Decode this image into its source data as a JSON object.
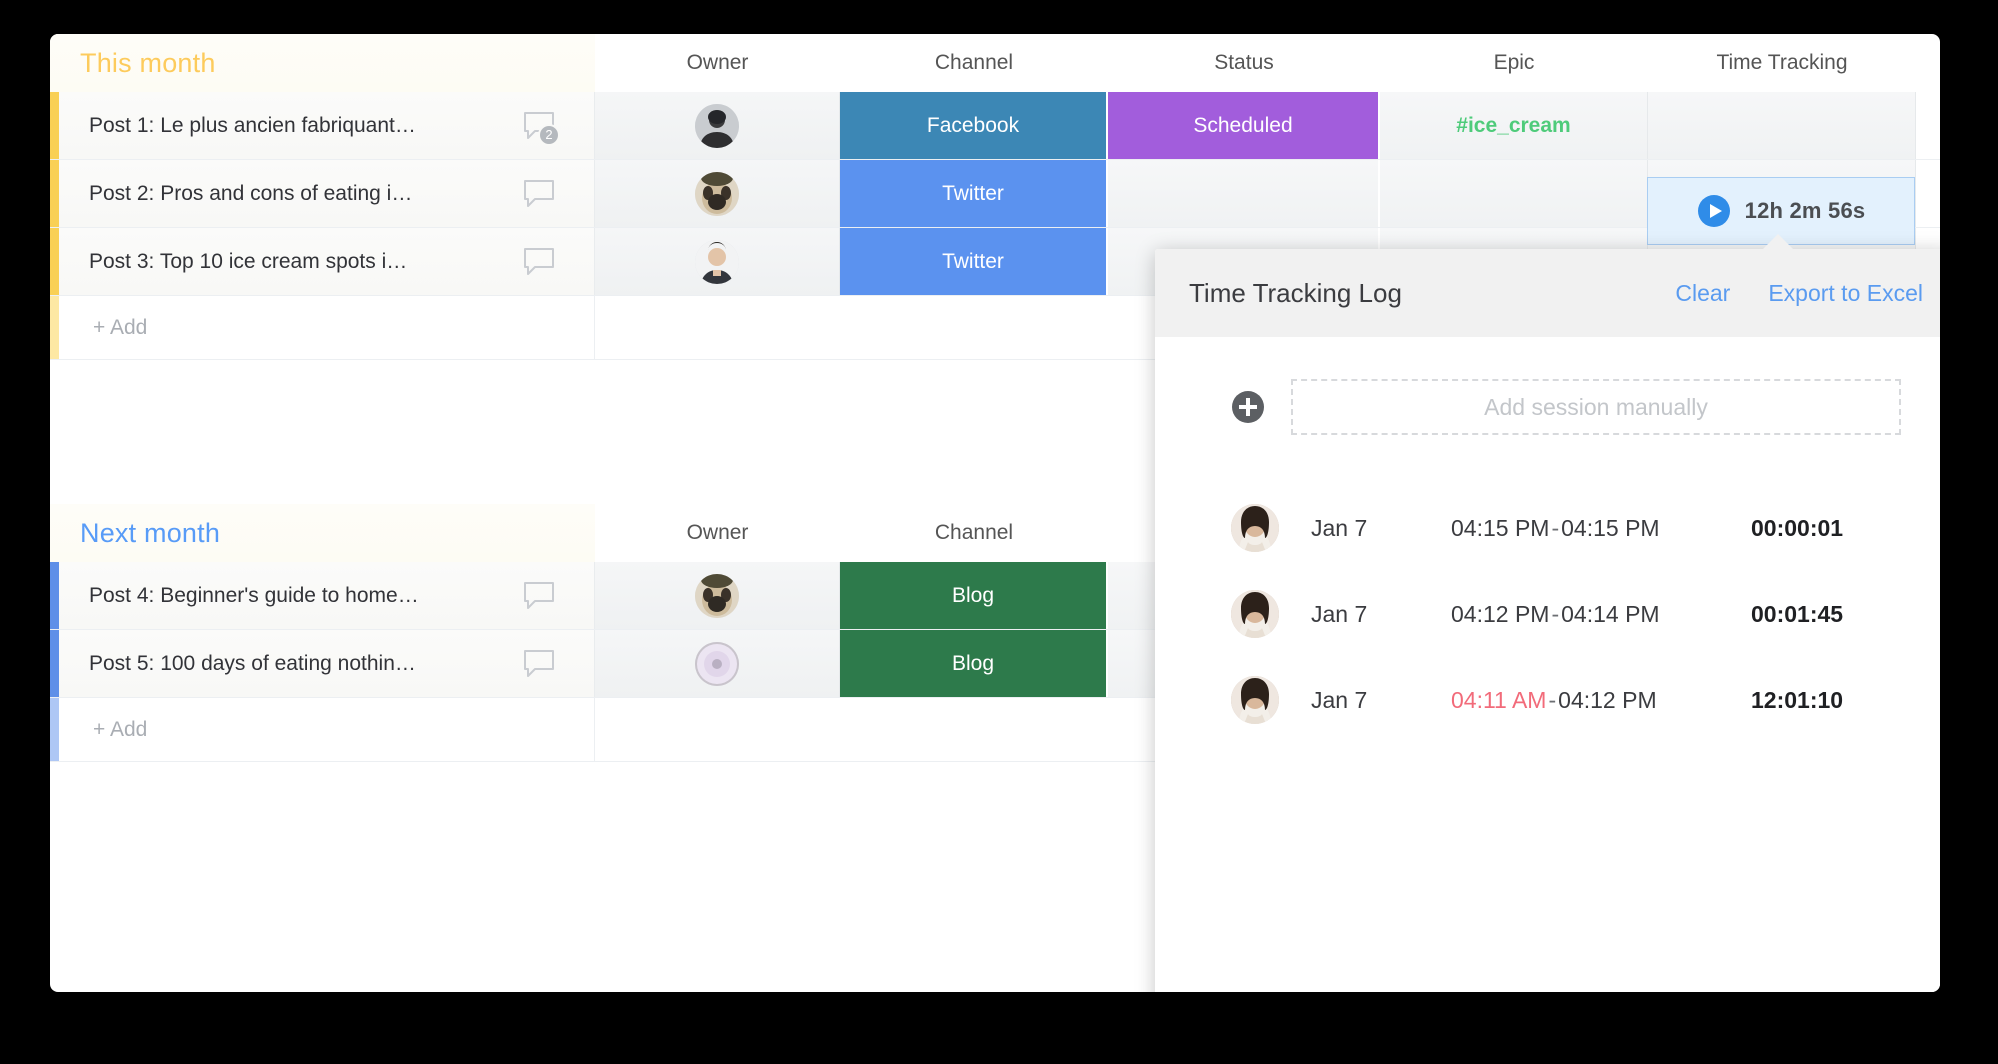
{
  "board": {
    "columns": [
      "Owner",
      "Channel",
      "Status",
      "Epic",
      "Time Tracking"
    ],
    "add_label": "+ Add",
    "groups": [
      {
        "title": "This month",
        "color": "#fdcb5c",
        "columns": [
          "Owner",
          "Channel",
          "Status",
          "Epic",
          "Time Tracking"
        ],
        "rows": [
          {
            "name": "Post 1: Le plus ancien fabriquant…",
            "comments": "2",
            "owner": "woman-dark-hair-avatar",
            "channel": "Facebook",
            "channel_color": "#3c87b5",
            "status": "Scheduled",
            "status_color": "#a25ddc",
            "epic": "#ice_cream",
            "epic_color": "#4ecb7a",
            "time": "12h 2m 56s"
          },
          {
            "name": "Post 2: Pros and cons of eating i…",
            "comments": "",
            "owner": "pug-dog-avatar",
            "channel": "Twitter",
            "channel_color": "#5b92ef",
            "status": "",
            "status_color": "",
            "epic": "",
            "epic_color": "",
            "time": ""
          },
          {
            "name": "Post 3: Top 10 ice cream spots i…",
            "comments": "",
            "owner": "man-avatar",
            "channel": "Twitter",
            "channel_color": "#5b92ef",
            "status": "",
            "status_color": "",
            "epic": "",
            "epic_color": "",
            "time": ""
          }
        ]
      },
      {
        "title": "Next month",
        "color": "#589bf7",
        "columns": [
          "Owner",
          "Channel",
          "Status",
          "Epic",
          "Time Tracking"
        ],
        "rows": [
          {
            "name": "Post 4: Beginner's guide to home…",
            "comments": "",
            "owner": "pug-dog-avatar",
            "channel": "Blog",
            "channel_color": "#2d7a4b",
            "status": "",
            "status_color": "",
            "epic": "",
            "epic_color": "",
            "time": ""
          },
          {
            "name": "Post 5: 100 days of eating nothin…",
            "comments": "",
            "owner": "flower-avatar",
            "channel": "Blog",
            "channel_color": "#2d7a4b",
            "status": "",
            "status_color": "",
            "epic": "",
            "epic_color": "",
            "time": ""
          }
        ]
      }
    ]
  },
  "time_tracking_cell": {
    "value": "12h 2m 56s",
    "play_icon": "play-circle-icon",
    "accent": "#2f8ce8"
  },
  "popup": {
    "title": "Time Tracking Log",
    "clear_label": "Clear",
    "export_label": "Export to Excel",
    "link_color": "#5a9bf0",
    "add_session": {
      "icon": "plus-circle-icon",
      "placeholder": "Add session manually"
    },
    "sessions": [
      {
        "avatar": "woman-long-hair-avatar",
        "date": "Jan 7",
        "start": "04:15 PM",
        "end": "04:15 PM",
        "separator": "-",
        "duration": "00:00:01",
        "start_warning": false
      },
      {
        "avatar": "woman-long-hair-avatar",
        "date": "Jan 7",
        "start": "04:12 PM",
        "end": "04:14 PM",
        "separator": "-",
        "duration": "00:01:45",
        "start_warning": false
      },
      {
        "avatar": "woman-long-hair-avatar",
        "date": "Jan 7",
        "start": "04:11 AM",
        "end": "04:12 PM",
        "separator": "-",
        "duration": "12:01:10",
        "start_warning": true,
        "warning_color": "#f26b7a"
      }
    ]
  }
}
